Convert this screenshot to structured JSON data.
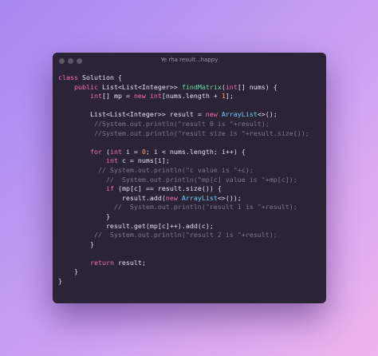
{
  "window": {
    "title": "Ye rha result...happy",
    "colors": {
      "background": "#2a2436",
      "keyword": "#f86fb2",
      "type": "#6ed3ff",
      "function": "#67e0a3",
      "number": "#ff9d66",
      "comment": "#7c7a8a",
      "text": "#e6e3ee"
    }
  },
  "code": {
    "lines": [
      [
        {
          "t": "class ",
          "c": "kw"
        },
        {
          "t": "Solution {",
          "c": "tx"
        }
      ],
      [
        {
          "t": "    "
        },
        {
          "t": "public ",
          "c": "kw"
        },
        {
          "t": "List<List<Integer>> "
        },
        {
          "t": "findMatrix",
          "c": "fn"
        },
        {
          "t": "("
        },
        {
          "t": "int",
          "c": "kw"
        },
        {
          "t": "[] nums) {"
        }
      ],
      [
        {
          "t": "        "
        },
        {
          "t": "int",
          "c": "kw"
        },
        {
          "t": "[] mp = "
        },
        {
          "t": "new ",
          "c": "kw"
        },
        {
          "t": "int",
          "c": "kw"
        },
        {
          "t": "[nums.length + "
        },
        {
          "t": "1",
          "c": "num"
        },
        {
          "t": "];"
        }
      ],
      [
        {
          "t": ""
        }
      ],
      [
        {
          "t": "        List<List<Integer>> result = "
        },
        {
          "t": "new ",
          "c": "kw"
        },
        {
          "t": "ArrayList",
          "c": "ty"
        },
        {
          "t": "<>();"
        }
      ],
      [
        {
          "t": "         //System.out.println(\"result 0 is \"+result);",
          "c": "cm"
        }
      ],
      [
        {
          "t": "         //System.out.println(\"result size is \"+result.size());",
          "c": "cm"
        }
      ],
      [
        {
          "t": ""
        }
      ],
      [
        {
          "t": "        "
        },
        {
          "t": "for ",
          "c": "kw"
        },
        {
          "t": "("
        },
        {
          "t": "int ",
          "c": "kw"
        },
        {
          "t": "i = "
        },
        {
          "t": "0",
          "c": "num"
        },
        {
          "t": "; i < nums.length; i++) {"
        }
      ],
      [
        {
          "t": "            "
        },
        {
          "t": "int ",
          "c": "kw"
        },
        {
          "t": "c = nums[i];"
        }
      ],
      [
        {
          "t": "          // System.out.println(\"c value is \"+c);",
          "c": "cm"
        }
      ],
      [
        {
          "t": "            //  System.out.println(\"mp[c] value is \"+mp[c]);",
          "c": "cm"
        }
      ],
      [
        {
          "t": "            "
        },
        {
          "t": "if ",
          "c": "kw"
        },
        {
          "t": "(mp[c] == result.size()) {"
        }
      ],
      [
        {
          "t": "                result.add("
        },
        {
          "t": "new ",
          "c": "kw"
        },
        {
          "t": "ArrayList",
          "c": "ty"
        },
        {
          "t": "<>());"
        }
      ],
      [
        {
          "t": "              //  System.out.println(\"result 1 is \"+result);",
          "c": "cm"
        }
      ],
      [
        {
          "t": "            }"
        }
      ],
      [
        {
          "t": "            result.get(mp[c]++).add(c);"
        }
      ],
      [
        {
          "t": "         //  System.out.println(\"result 2 is \"+result);",
          "c": "cm"
        }
      ],
      [
        {
          "t": "        }"
        }
      ],
      [
        {
          "t": ""
        }
      ],
      [
        {
          "t": "        "
        },
        {
          "t": "return ",
          "c": "kw"
        },
        {
          "t": "result;"
        }
      ],
      [
        {
          "t": "    }"
        }
      ],
      [
        {
          "t": "}"
        }
      ]
    ]
  }
}
